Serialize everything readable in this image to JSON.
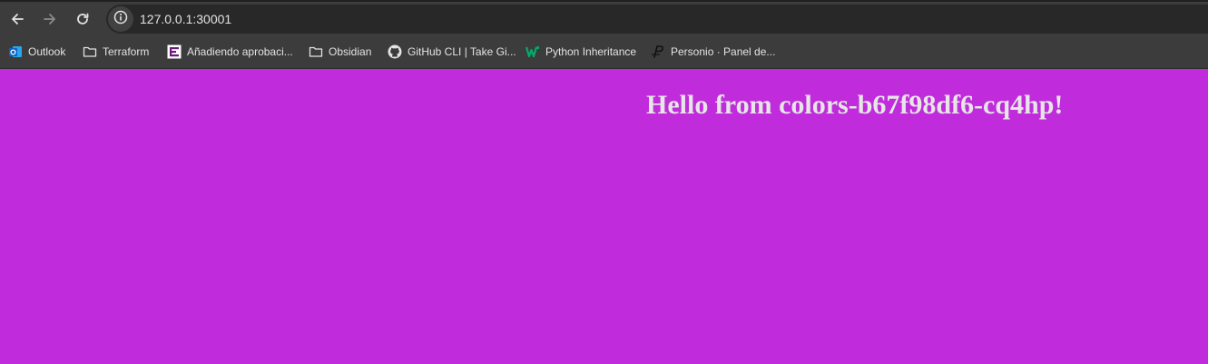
{
  "browser": {
    "back_icon": "arrow-left-icon",
    "forward_icon": "arrow-right-icon",
    "reload_icon": "reload-icon",
    "site_info_icon": "info-icon",
    "url": "127.0.0.1:30001",
    "toolbar_color": "#3c3c3c",
    "omnibox_color": "#282828"
  },
  "bookmarks": [
    {
      "label": "Outlook",
      "icon": "outlook-icon"
    },
    {
      "label": "Terraform",
      "icon": "folder-icon"
    },
    {
      "label": "Añadiendo aprobaci...",
      "icon": "app-icon"
    },
    {
      "label": "Obsidian",
      "icon": "folder-icon"
    },
    {
      "label": "GitHub CLI | Take Gi...",
      "icon": "github-icon"
    },
    {
      "label": "Python Inheritance",
      "icon": "w3schools-icon"
    },
    {
      "label": "Personio · Panel de...",
      "icon": "personio-icon"
    }
  ],
  "page": {
    "heading": "Hello from colors-b67f98df6-cq4hp!",
    "background_color": "#c02cdc",
    "text_color": "#e6e6e6"
  }
}
